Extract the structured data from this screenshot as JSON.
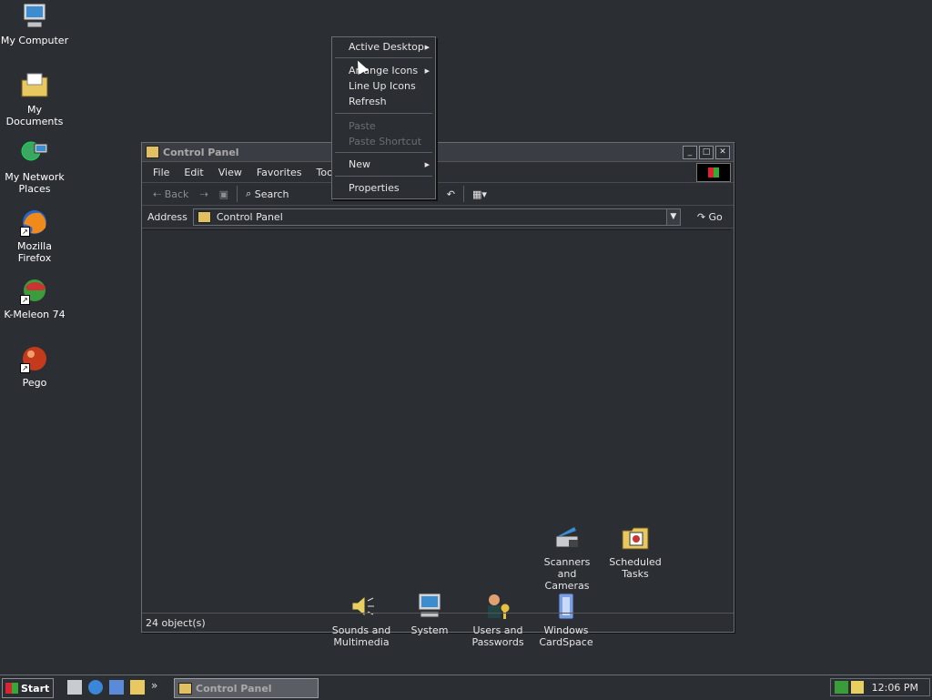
{
  "desktop_icons": [
    {
      "label": "My Computer",
      "icon": "my-computer-icon"
    },
    {
      "label": "My Documents",
      "icon": "my-documents-icon"
    },
    {
      "label": "My Network Places",
      "icon": "network-places-icon"
    },
    {
      "label": "Mozilla Firefox",
      "icon": "firefox-icon"
    },
    {
      "label": "K-Meleon 74",
      "icon": "kmeleon-icon"
    },
    {
      "label": "Pego",
      "icon": "pego-icon"
    }
  ],
  "window": {
    "title": "Control Panel",
    "menu": [
      "File",
      "Edit",
      "View",
      "Favorites",
      "Tools"
    ],
    "toolbar": {
      "back": "Back",
      "search": "Search"
    },
    "address": {
      "label": "Address",
      "value": "Control Panel",
      "go": "Go"
    },
    "status": "24 object(s)",
    "items": [
      {
        "label": "Scanners and Cameras",
        "icon": "scanner-icon"
      },
      {
        "label": "Scheduled Tasks",
        "icon": "scheduled-tasks-icon"
      },
      {
        "label": "Sounds and Multimedia",
        "icon": "speaker-icon"
      },
      {
        "label": "System",
        "icon": "system-icon"
      },
      {
        "label": "Users and Passwords",
        "icon": "users-icon"
      },
      {
        "label": "Windows CardSpace",
        "icon": "cardspace-icon"
      }
    ]
  },
  "context_menu": {
    "items": [
      {
        "label": "Active Desktop",
        "submenu": true,
        "disabled": false
      },
      {
        "label": "Arrange Icons",
        "submenu": true,
        "disabled": false
      },
      {
        "label": "Line Up Icons",
        "submenu": false,
        "disabled": false
      },
      {
        "label": "Refresh",
        "submenu": false,
        "disabled": false
      },
      {
        "label": "Paste",
        "submenu": false,
        "disabled": true
      },
      {
        "label": "Paste Shortcut",
        "submenu": false,
        "disabled": true
      },
      {
        "label": "New",
        "submenu": true,
        "disabled": false
      },
      {
        "label": "Properties",
        "submenu": false,
        "disabled": false
      }
    ]
  },
  "taskbar": {
    "start_label": "Start",
    "task_label": "Control Panel",
    "clock": "12:06 PM"
  }
}
